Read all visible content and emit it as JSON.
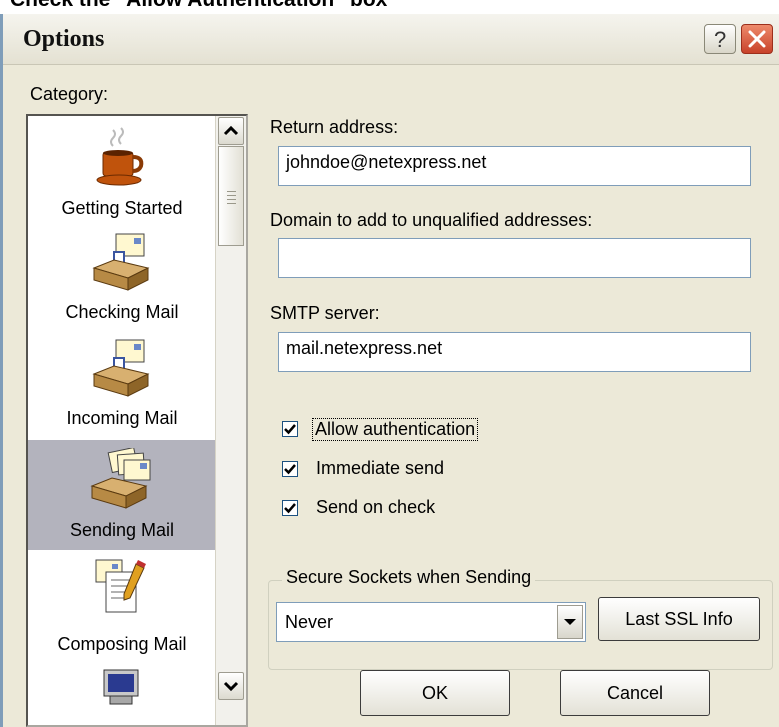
{
  "caption": "Check the \"Allow Authentication\" box",
  "window": {
    "title": "Options",
    "help_glyph": "?"
  },
  "category_label": "Category:",
  "categories": [
    {
      "label": "Getting Started",
      "icon": "coffee-cup-icon",
      "selected": false
    },
    {
      "label": "Checking Mail",
      "icon": "mailbox-check-icon",
      "selected": false
    },
    {
      "label": "Incoming Mail",
      "icon": "mailbox-incoming-icon",
      "selected": false
    },
    {
      "label": "Sending Mail",
      "icon": "mailbox-sending-icon",
      "selected": true
    },
    {
      "label": "Composing Mail",
      "icon": "composing-document-icon",
      "selected": false
    }
  ],
  "fields": {
    "return_address": {
      "label": "Return address:",
      "value": "johndoe@netexpress.net"
    },
    "domain": {
      "label": "Domain to add to unqualified addresses:",
      "value": ""
    },
    "smtp": {
      "label": "SMTP server:",
      "value": "mail.netexpress.net"
    }
  },
  "checkboxes": [
    {
      "label": "Allow authentication",
      "checked": true
    },
    {
      "label": "Immediate send",
      "checked": true
    },
    {
      "label": "Send on check",
      "checked": true
    }
  ],
  "ssl": {
    "group_title": "Secure Sockets when Sending",
    "selected": "Never",
    "last_ssl_button": "Last SSL Info"
  },
  "buttons": {
    "ok": "OK",
    "cancel": "Cancel"
  },
  "colors": {
    "selected_category_bg": "#b3b3bd",
    "dialog_bg": "#ece9d8",
    "field_border": "#7f9db9"
  }
}
